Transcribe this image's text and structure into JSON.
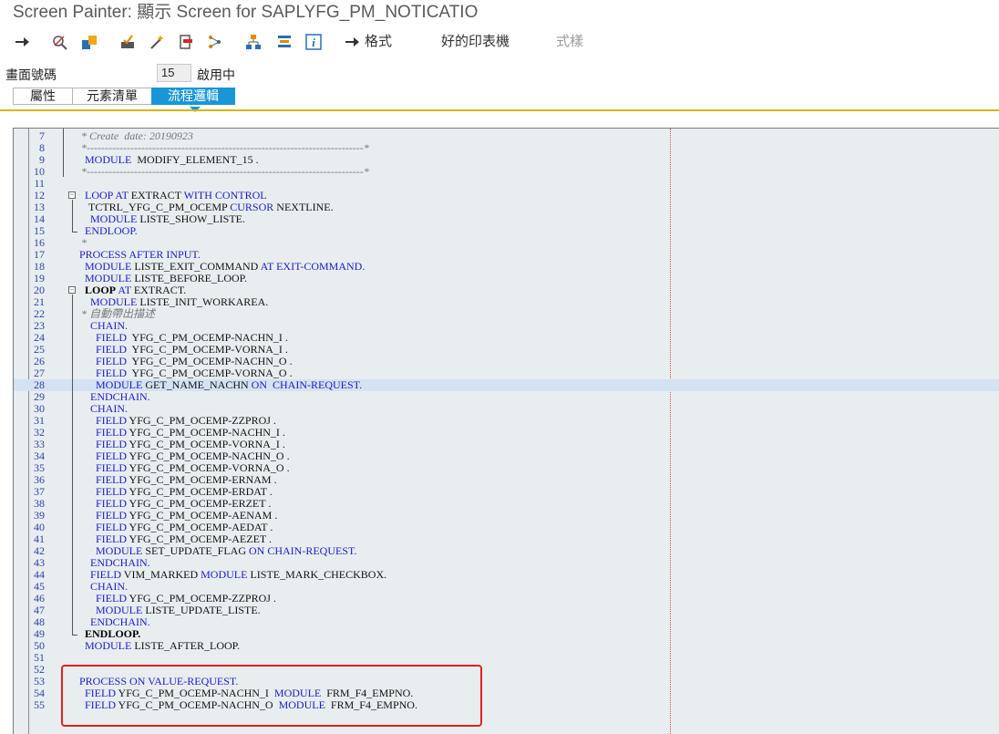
{
  "window": {
    "title": "Screen Painter: 顯示 Screen for SAPLYFG_PM_NOTICATIO"
  },
  "toolbar": {
    "icons": [
      {
        "name": "back-arrow-icon"
      },
      {
        "name": "display-change-icon"
      },
      {
        "name": "activate-icon"
      },
      {
        "name": "check-icon"
      },
      {
        "name": "test-icon"
      },
      {
        "name": "other-object-icon"
      },
      {
        "name": "where-used-icon"
      },
      {
        "name": "hierarchy-icon"
      },
      {
        "name": "layout-icon"
      },
      {
        "name": "info-icon"
      }
    ],
    "format_label": "格式",
    "pretty_print_label": "好的印表機",
    "pattern_label": "式樣"
  },
  "screen_number": {
    "label": "畫面號碼",
    "value": "15",
    "status": "啟用中"
  },
  "tabs": [
    {
      "label": "屬性"
    },
    {
      "label": "元素清單"
    },
    {
      "label": "流程邏輯"
    }
  ],
  "editor": {
    "lines": [
      {
        "no": "7",
        "tokens": [
          {
            "t": "* Create  date: 20190923",
            "c": "cmt"
          }
        ]
      },
      {
        "no": "8",
        "tokens": [
          {
            "t": "*----------------------------------------------------------------------------*",
            "c": "cmt"
          }
        ]
      },
      {
        "no": "9",
        "tokens": [
          {
            "t": "MODULE",
            "c": "kw"
          },
          {
            "t": "  MODIFY_ELEMENT_15 .",
            "c": "plain"
          }
        ]
      },
      {
        "no": "10",
        "tokens": [
          {
            "t": "*----------------------------------------------------------------------------*",
            "c": "cmt"
          }
        ]
      },
      {
        "no": "11",
        "tokens": []
      },
      {
        "no": "12",
        "tokens": [
          {
            "t": "LOOP AT",
            "c": "kw"
          },
          {
            "t": " EXTRACT ",
            "c": "plain"
          },
          {
            "t": "WITH CONTROL",
            "c": "kw"
          }
        ]
      },
      {
        "no": "13",
        "tokens": [
          {
            "t": "TCTRL_YFG_C_PM_OCEMP ",
            "c": "plain"
          },
          {
            "t": "CURSOR",
            "c": "kw"
          },
          {
            "t": " NEXTLINE.",
            "c": "plain"
          }
        ]
      },
      {
        "no": "14",
        "tokens": [
          {
            "t": "MODULE",
            "c": "kw"
          },
          {
            "t": " LISTE_SHOW_LISTE.",
            "c": "plain"
          }
        ]
      },
      {
        "no": "15",
        "tokens": [
          {
            "t": "ENDLOOP.",
            "c": "kw"
          }
        ]
      },
      {
        "no": "16",
        "tokens": [
          {
            "t": "*",
            "c": "cmt"
          }
        ]
      },
      {
        "no": "17",
        "tokens": [
          {
            "t": "PROCESS AFTER INPUT.",
            "c": "kw"
          }
        ]
      },
      {
        "no": "18",
        "tokens": [
          {
            "t": "MODULE",
            "c": "kw"
          },
          {
            "t": " LISTE_EXIT_COMMAND ",
            "c": "plain"
          },
          {
            "t": "AT EXIT-COMMAND.",
            "c": "kw"
          }
        ]
      },
      {
        "no": "19",
        "tokens": [
          {
            "t": "MODULE",
            "c": "kw"
          },
          {
            "t": " LISTE_BEFORE_LOOP.",
            "c": "plain"
          }
        ]
      },
      {
        "no": "20",
        "tokens": [
          {
            "t": "LOOP",
            "c": "bold"
          },
          {
            "t": " AT",
            "c": "kw"
          },
          {
            "t": " EXTRACT.",
            "c": "plain"
          }
        ]
      },
      {
        "no": "21",
        "tokens": [
          {
            "t": "MODULE",
            "c": "kw"
          },
          {
            "t": " LISTE_INIT_WORKAREA.",
            "c": "plain"
          }
        ]
      },
      {
        "no": "22",
        "tokens": [
          {
            "t": "* 自動帶出描述",
            "c": "cmt"
          }
        ]
      },
      {
        "no": "23",
        "tokens": [
          {
            "t": "CHAIN.",
            "c": "kw"
          }
        ]
      },
      {
        "no": "24",
        "tokens": [
          {
            "t": "FIELD",
            "c": "kw"
          },
          {
            "t": "  YFG_C_PM_OCEMP-NACHN_I .",
            "c": "plain"
          }
        ]
      },
      {
        "no": "25",
        "tokens": [
          {
            "t": "FIELD",
            "c": "kw"
          },
          {
            "t": "  YFG_C_PM_OCEMP-VORNA_I .",
            "c": "plain"
          }
        ]
      },
      {
        "no": "26",
        "tokens": [
          {
            "t": "FIELD",
            "c": "kw"
          },
          {
            "t": "  YFG_C_PM_OCEMP-NACHN_O .",
            "c": "plain"
          }
        ]
      },
      {
        "no": "27",
        "tokens": [
          {
            "t": "FIELD",
            "c": "kw"
          },
          {
            "t": "  YFG_C_PM_OCEMP-VORNA_O .",
            "c": "plain"
          }
        ]
      },
      {
        "no": "28",
        "tokens": [
          {
            "t": "MODULE",
            "c": "kw"
          },
          {
            "t": " GET_NAME_NACHN ",
            "c": "plain"
          },
          {
            "t": "ON  CHAIN-REQUEST.",
            "c": "kw"
          }
        ]
      },
      {
        "no": "29",
        "tokens": [
          {
            "t": "ENDCHAIN.",
            "c": "kw"
          }
        ]
      },
      {
        "no": "30",
        "tokens": [
          {
            "t": "CHAIN.",
            "c": "kw"
          }
        ]
      },
      {
        "no": "31",
        "tokens": [
          {
            "t": "FIELD",
            "c": "kw"
          },
          {
            "t": " YFG_C_PM_OCEMP-ZZPROJ .",
            "c": "plain"
          }
        ]
      },
      {
        "no": "32",
        "tokens": [
          {
            "t": "FIELD",
            "c": "kw"
          },
          {
            "t": " YFG_C_PM_OCEMP-NACHN_I .",
            "c": "plain"
          }
        ]
      },
      {
        "no": "33",
        "tokens": [
          {
            "t": "FIELD",
            "c": "kw"
          },
          {
            "t": " YFG_C_PM_OCEMP-VORNA_I .",
            "c": "plain"
          }
        ]
      },
      {
        "no": "34",
        "tokens": [
          {
            "t": "FIELD",
            "c": "kw"
          },
          {
            "t": " YFG_C_PM_OCEMP-NACHN_O .",
            "c": "plain"
          }
        ]
      },
      {
        "no": "35",
        "tokens": [
          {
            "t": "FIELD",
            "c": "kw"
          },
          {
            "t": " YFG_C_PM_OCEMP-VORNA_O .",
            "c": "plain"
          }
        ]
      },
      {
        "no": "36",
        "tokens": [
          {
            "t": "FIELD",
            "c": "kw"
          },
          {
            "t": " YFG_C_PM_OCEMP-ERNAM .",
            "c": "plain"
          }
        ]
      },
      {
        "no": "37",
        "tokens": [
          {
            "t": "FIELD",
            "c": "kw"
          },
          {
            "t": " YFG_C_PM_OCEMP-ERDAT .",
            "c": "plain"
          }
        ]
      },
      {
        "no": "38",
        "tokens": [
          {
            "t": "FIELD",
            "c": "kw"
          },
          {
            "t": " YFG_C_PM_OCEMP-ERZET .",
            "c": "plain"
          }
        ]
      },
      {
        "no": "39",
        "tokens": [
          {
            "t": "FIELD",
            "c": "kw"
          },
          {
            "t": " YFG_C_PM_OCEMP-AENAM .",
            "c": "plain"
          }
        ]
      },
      {
        "no": "40",
        "tokens": [
          {
            "t": "FIELD",
            "c": "kw"
          },
          {
            "t": " YFG_C_PM_OCEMP-AEDAT .",
            "c": "plain"
          }
        ]
      },
      {
        "no": "41",
        "tokens": [
          {
            "t": "FIELD",
            "c": "kw"
          },
          {
            "t": " YFG_C_PM_OCEMP-AEZET .",
            "c": "plain"
          }
        ]
      },
      {
        "no": "42",
        "tokens": [
          {
            "t": "MODULE",
            "c": "kw"
          },
          {
            "t": " SET_UPDATE_FLAG ",
            "c": "plain"
          },
          {
            "t": "ON CHAIN-REQUEST.",
            "c": "kw"
          }
        ]
      },
      {
        "no": "43",
        "tokens": [
          {
            "t": "ENDCHAIN.",
            "c": "kw"
          }
        ]
      },
      {
        "no": "44",
        "tokens": [
          {
            "t": "FIELD",
            "c": "kw"
          },
          {
            "t": " VIM_MARKED ",
            "c": "plain"
          },
          {
            "t": "MODULE",
            "c": "kw"
          },
          {
            "t": " LISTE_MARK_CHECKBOX.",
            "c": "plain"
          }
        ]
      },
      {
        "no": "45",
        "tokens": [
          {
            "t": "CHAIN.",
            "c": "kw"
          }
        ]
      },
      {
        "no": "46",
        "tokens": [
          {
            "t": "FIELD",
            "c": "kw"
          },
          {
            "t": " YFG_C_PM_OCEMP-ZZPROJ .",
            "c": "plain"
          }
        ]
      },
      {
        "no": "47",
        "tokens": [
          {
            "t": "MODULE",
            "c": "kw"
          },
          {
            "t": " LISTE_UPDATE_LISTE.",
            "c": "plain"
          }
        ]
      },
      {
        "no": "48",
        "tokens": [
          {
            "t": "ENDCHAIN.",
            "c": "kw"
          }
        ]
      },
      {
        "no": "49",
        "tokens": [
          {
            "t": "ENDLOOP.",
            "c": "bold"
          }
        ]
      },
      {
        "no": "50",
        "tokens": [
          {
            "t": "MODULE",
            "c": "kw"
          },
          {
            "t": " LISTE_AFTER_LOOP.",
            "c": "plain"
          }
        ]
      },
      {
        "no": "51",
        "tokens": []
      },
      {
        "no": "52",
        "tokens": []
      },
      {
        "no": "53",
        "tokens": [
          {
            "t": "PROCESS ON VALUE-REQUEST.",
            "c": "kw"
          }
        ]
      },
      {
        "no": "54",
        "tokens": [
          {
            "t": "FIELD",
            "c": "kw"
          },
          {
            "t": " YFG_C_PM_OCEMP-NACHN_I  ",
            "c": "plain"
          },
          {
            "t": "MODULE",
            "c": "kw"
          },
          {
            "t": "  FRM_F4_EMPNO.",
            "c": "plain"
          }
        ]
      },
      {
        "no": "55",
        "tokens": [
          {
            "t": "FIELD",
            "c": "kw"
          },
          {
            "t": " YFG_C_PM_OCEMP-NACHN_O  ",
            "c": "plain"
          },
          {
            "t": "MODULE",
            "c": "kw"
          },
          {
            "t": "  FRM_F4_EMPNO.",
            "c": "plain"
          }
        ]
      }
    ]
  }
}
